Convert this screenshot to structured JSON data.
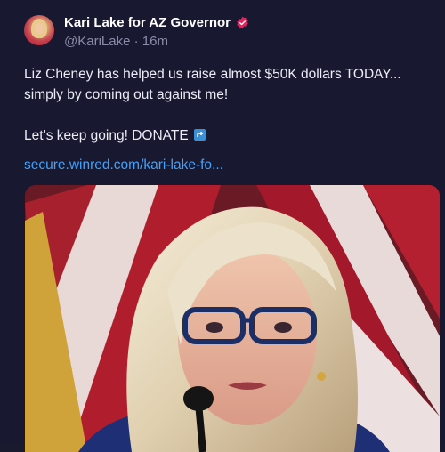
{
  "author": {
    "name": "Kari Lake for AZ Governor",
    "handle": "@KariLake",
    "separator": "·",
    "time": "16m",
    "verified_icon": "verified-badge-icon",
    "verified_color": "#e0245e"
  },
  "tweet": {
    "line1": "Liz Cheney has helped us raise almost $50K dollars TODAY...",
    "line2": "simply by coming out against me!",
    "line3": "Let’s keep going! DONATE",
    "donate_icon": "arrow-curved-icon",
    "link": "secure.winred.com/kari-lake-fo..."
  },
  "colors": {
    "background": "#181830",
    "text": "#ececf4",
    "muted": "#8c8ca8",
    "link": "#3fa3ff"
  }
}
